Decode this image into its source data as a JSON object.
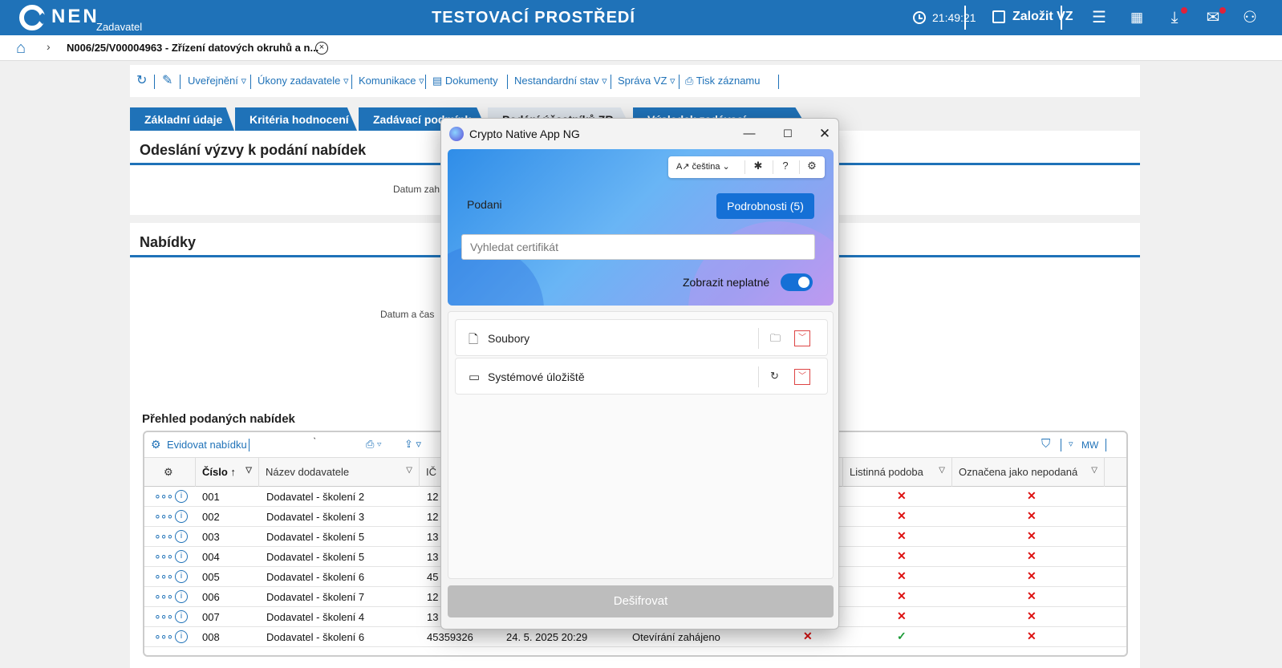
{
  "topbar": {
    "brand": "NEN",
    "brand_sub": "Zadavatel",
    "env_title": "TESTOVACÍ PROSTŘEDÍ",
    "time": "21:49:21",
    "zalozit": "Založit VZ",
    "icons": [
      "clock-icon",
      "edit-icon",
      "menu-icon",
      "calendar-icon",
      "download-icon",
      "mail-icon",
      "user-icon"
    ]
  },
  "breadcrumb": {
    "text": "N006/25/V00004963 - Zřízení datových okruhů a n..."
  },
  "toolbar": {
    "items": [
      "Uveřejnění",
      "Úkony zadavatele",
      "Komunikace",
      "Dokumenty",
      "Nestandardní stav",
      "Správa VZ",
      "Tisk záznamu"
    ]
  },
  "tabs": [
    "Základní údaje",
    "Kritéria hodnocení",
    "Zadávací podmínk",
    "Podání účastníků ZR",
    "Výsledek zadávací..."
  ],
  "section1": {
    "title": "Odeslání výzvy k podání nabídek",
    "label": "Datum zah"
  },
  "section2": {
    "title": "Nabídky",
    "label": "Datum a čas"
  },
  "grid": {
    "title": "Přehled podaných nabídek",
    "evidovat": "Evidovat nabídku",
    "tick": "ˋ",
    "mw": "MW",
    "headers": {
      "cislo": "Číslo",
      "nazev": "Název dodavatele",
      "ico": "IČ",
      "listinna": "Listinná podoba",
      "nepodana": "Označena jako nepodaná"
    },
    "rows": [
      {
        "cislo": "001",
        "nazev": "Dodavatel - školení 2",
        "ico": "12"
      },
      {
        "cislo": "002",
        "nazev": "Dodavatel - školení 3",
        "ico": "12"
      },
      {
        "cislo": "003",
        "nazev": "Dodavatel - školení 5",
        "ico": "13"
      },
      {
        "cislo": "004",
        "nazev": "Dodavatel - školení 5",
        "ico": "13"
      },
      {
        "cislo": "005",
        "nazev": "Dodavatel - školení 6",
        "ico": "45"
      },
      {
        "cislo": "006",
        "nazev": "Dodavatel - školení 7",
        "ico": "12"
      },
      {
        "cislo": "007",
        "nazev": "Dodavatel - školení 4",
        "ico": "13"
      },
      {
        "cislo": "008",
        "nazev": "Dodavatel - školení 6",
        "ico": "45359326",
        "datum": "24. 5. 2025 20:29",
        "stav": "Otevírání zahájeno"
      }
    ]
  },
  "dialog": {
    "title": "Crypto Native App NG",
    "language": "čeština",
    "podani": "Podani",
    "details_button": "Podrobnosti (5)",
    "search_placeholder": "Vyhledat certifikát",
    "toggle_label": "Zobrazit neplatné",
    "toggle_on": true,
    "stores": [
      {
        "label": "Soubory",
        "icon": "file-icon",
        "action_icon": "folder-icon"
      },
      {
        "label": "Systémové úložiště",
        "icon": "laptop-icon",
        "action_icon": "refresh-icon"
      }
    ],
    "decrypt_button": "Dešifrovat"
  },
  "colors": {
    "brand_blue": "#1f72b8",
    "dialog_blue": "#1570d6",
    "status_red": "#dd1111",
    "status_green": "#1a9a36"
  }
}
